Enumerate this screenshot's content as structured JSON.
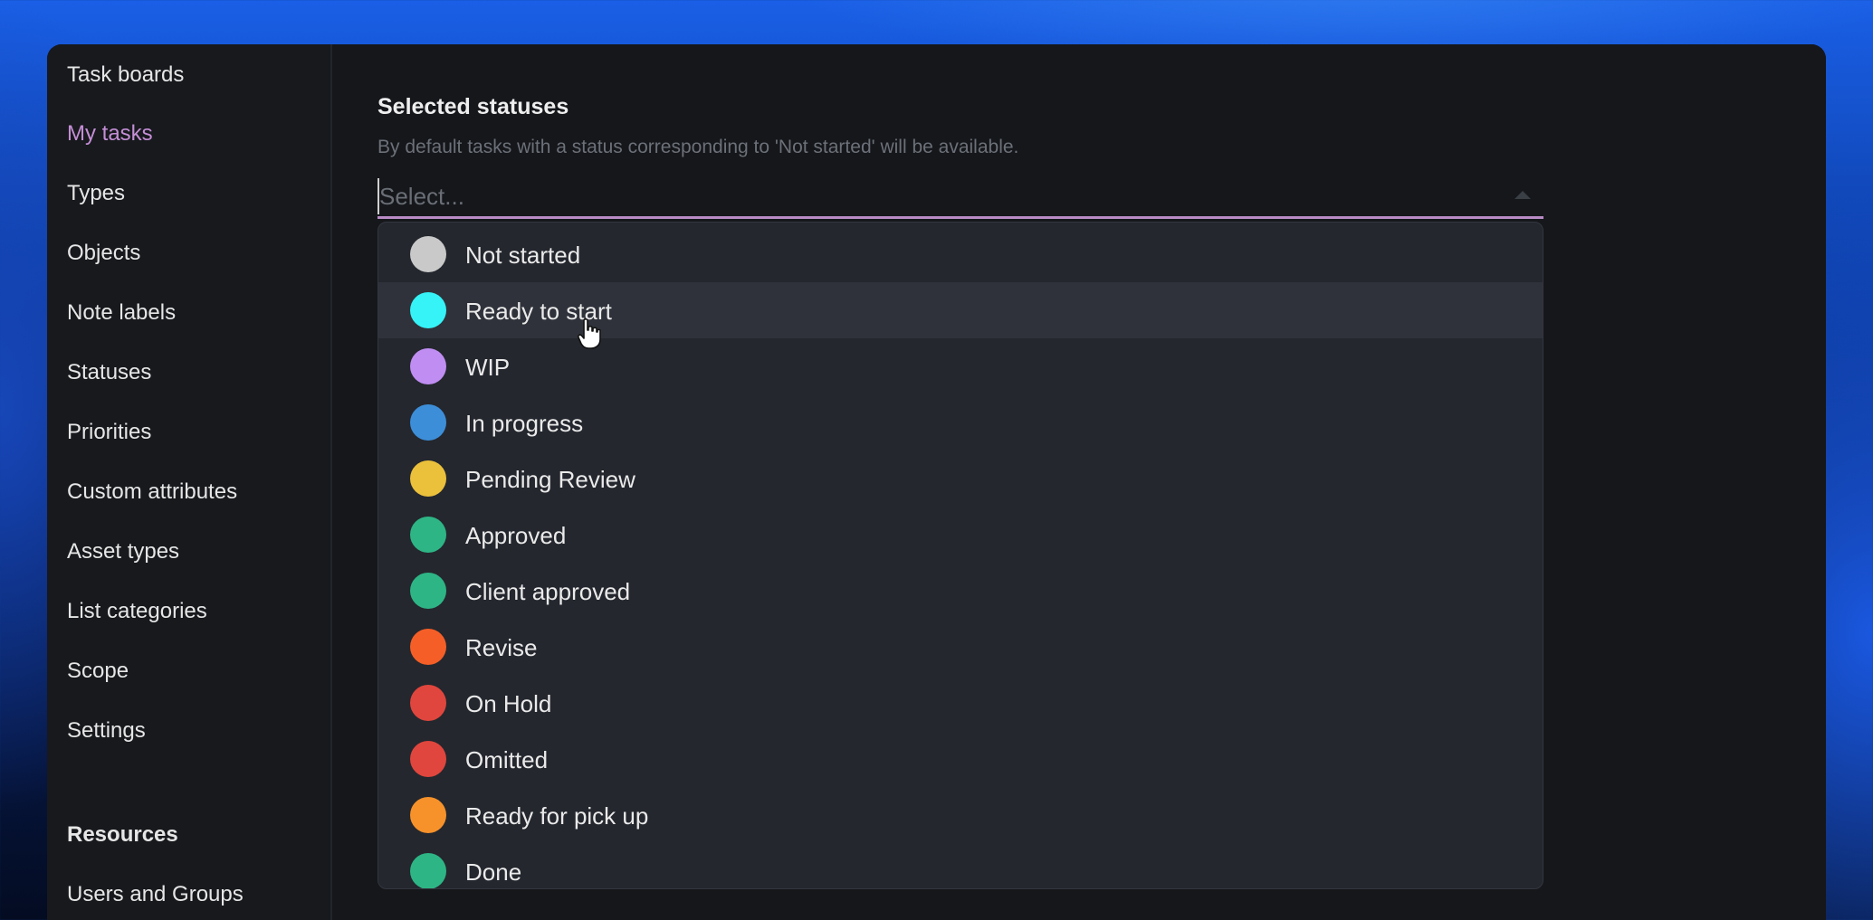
{
  "sidebar": {
    "items": [
      {
        "label": "Task boards"
      },
      {
        "label": "My tasks",
        "active": true
      },
      {
        "label": "Types"
      },
      {
        "label": "Objects"
      },
      {
        "label": "Note labels"
      },
      {
        "label": "Statuses"
      },
      {
        "label": "Priorities"
      },
      {
        "label": "Custom attributes"
      },
      {
        "label": "Asset types"
      },
      {
        "label": "List categories"
      },
      {
        "label": "Scope"
      },
      {
        "label": "Settings"
      }
    ],
    "resources_heading": "Resources",
    "resources_items": [
      {
        "label": "Users and Groups"
      }
    ],
    "active_color": "#c58ed6"
  },
  "field": {
    "label": "Selected statuses",
    "help": "By default tasks with a status corresponding to 'Not started' will be available.",
    "placeholder": "Select...",
    "value": ""
  },
  "dropdown": {
    "hovered_item": "Ready to start",
    "options": [
      {
        "label": "Not started",
        "color": "#c9c9c9"
      },
      {
        "label": "Ready to start",
        "color": "#35f3f7"
      },
      {
        "label": "WIP",
        "color": "#c08ef2"
      },
      {
        "label": "In progress",
        "color": "#3d8ed8"
      },
      {
        "label": "Pending Review",
        "color": "#ebc03b"
      },
      {
        "label": "Approved",
        "color": "#2eb585"
      },
      {
        "label": "Client approved",
        "color": "#2eb585"
      },
      {
        "label": "Revise",
        "color": "#f55f27"
      },
      {
        "label": "On Hold",
        "color": "#e0463d"
      },
      {
        "label": "Omitted",
        "color": "#e0463d"
      },
      {
        "label": "Ready for pick up",
        "color": "#f7922a"
      },
      {
        "label": "Done",
        "color": "#2eb585"
      }
    ]
  },
  "icons": {
    "dropdown_caret": "caret-up-icon",
    "cursor": "hand-pointer-icon"
  }
}
